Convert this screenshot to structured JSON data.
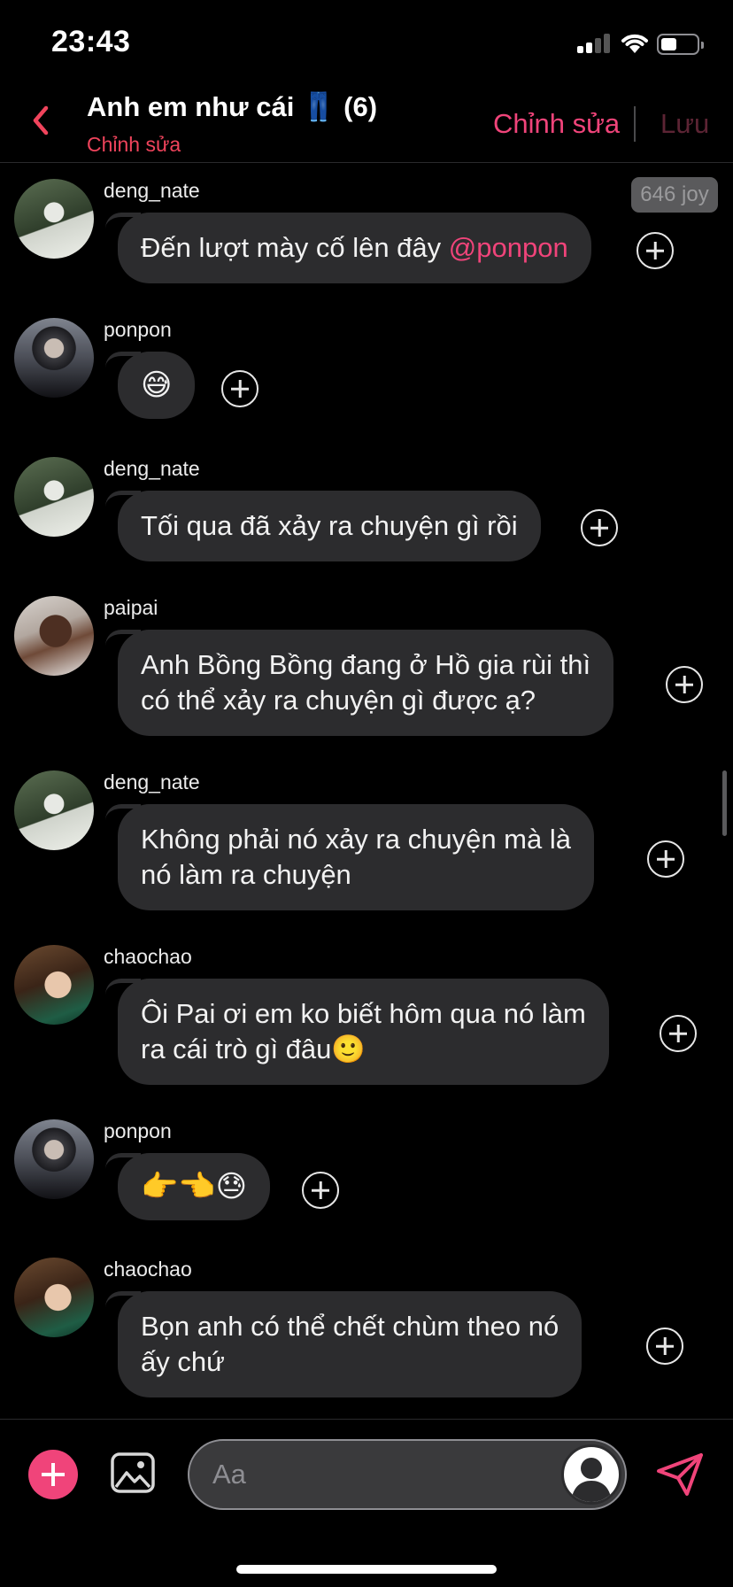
{
  "status_bar": {
    "time": "23:43"
  },
  "header": {
    "title": "Anh em như cái 👖 (6)",
    "subtitle": "Chỉnh sửa",
    "edit_label": "Chỉnh sửa",
    "save_label": "Lưu"
  },
  "joy_badge": "646 joy",
  "messages": [
    {
      "user": "deng_nate",
      "text": "Đến lượt mày cố lên đây ",
      "mention": "@ponpon"
    },
    {
      "user": "ponpon",
      "text": "😅"
    },
    {
      "user": "deng_nate",
      "text": "Tối qua đã xảy ra chuyện gì rồi"
    },
    {
      "user": "paipai",
      "line1": "Anh Bồng Bồng đang ở Hồ gia rùi thì",
      "line2": "có thể xảy ra chuyện gì được ạ?"
    },
    {
      "user": "deng_nate",
      "line1": "Không phải nó xảy ra chuyện mà là",
      "line2": "nó làm ra chuyện"
    },
    {
      "user": "chaochao",
      "line1": "Ôi Pai ơi em ko biết hôm qua nó làm",
      "line2": "ra cái trò gì đâu🙂"
    },
    {
      "user": "ponpon",
      "text": "👉👈😓"
    },
    {
      "user": "chaochao",
      "line1": "Bọn anh có thể chết chùm theo nó",
      "line2": "ấy chứ"
    }
  ],
  "composer": {
    "placeholder": "Aa"
  },
  "colors": {
    "accent": "#f0447a",
    "bubble": "#2c2c2e",
    "background": "#000000"
  },
  "icons": [
    "back-chevron-icon",
    "add-reaction-icon",
    "plus-icon",
    "image-icon",
    "send-icon",
    "persona-avatar-icon"
  ]
}
